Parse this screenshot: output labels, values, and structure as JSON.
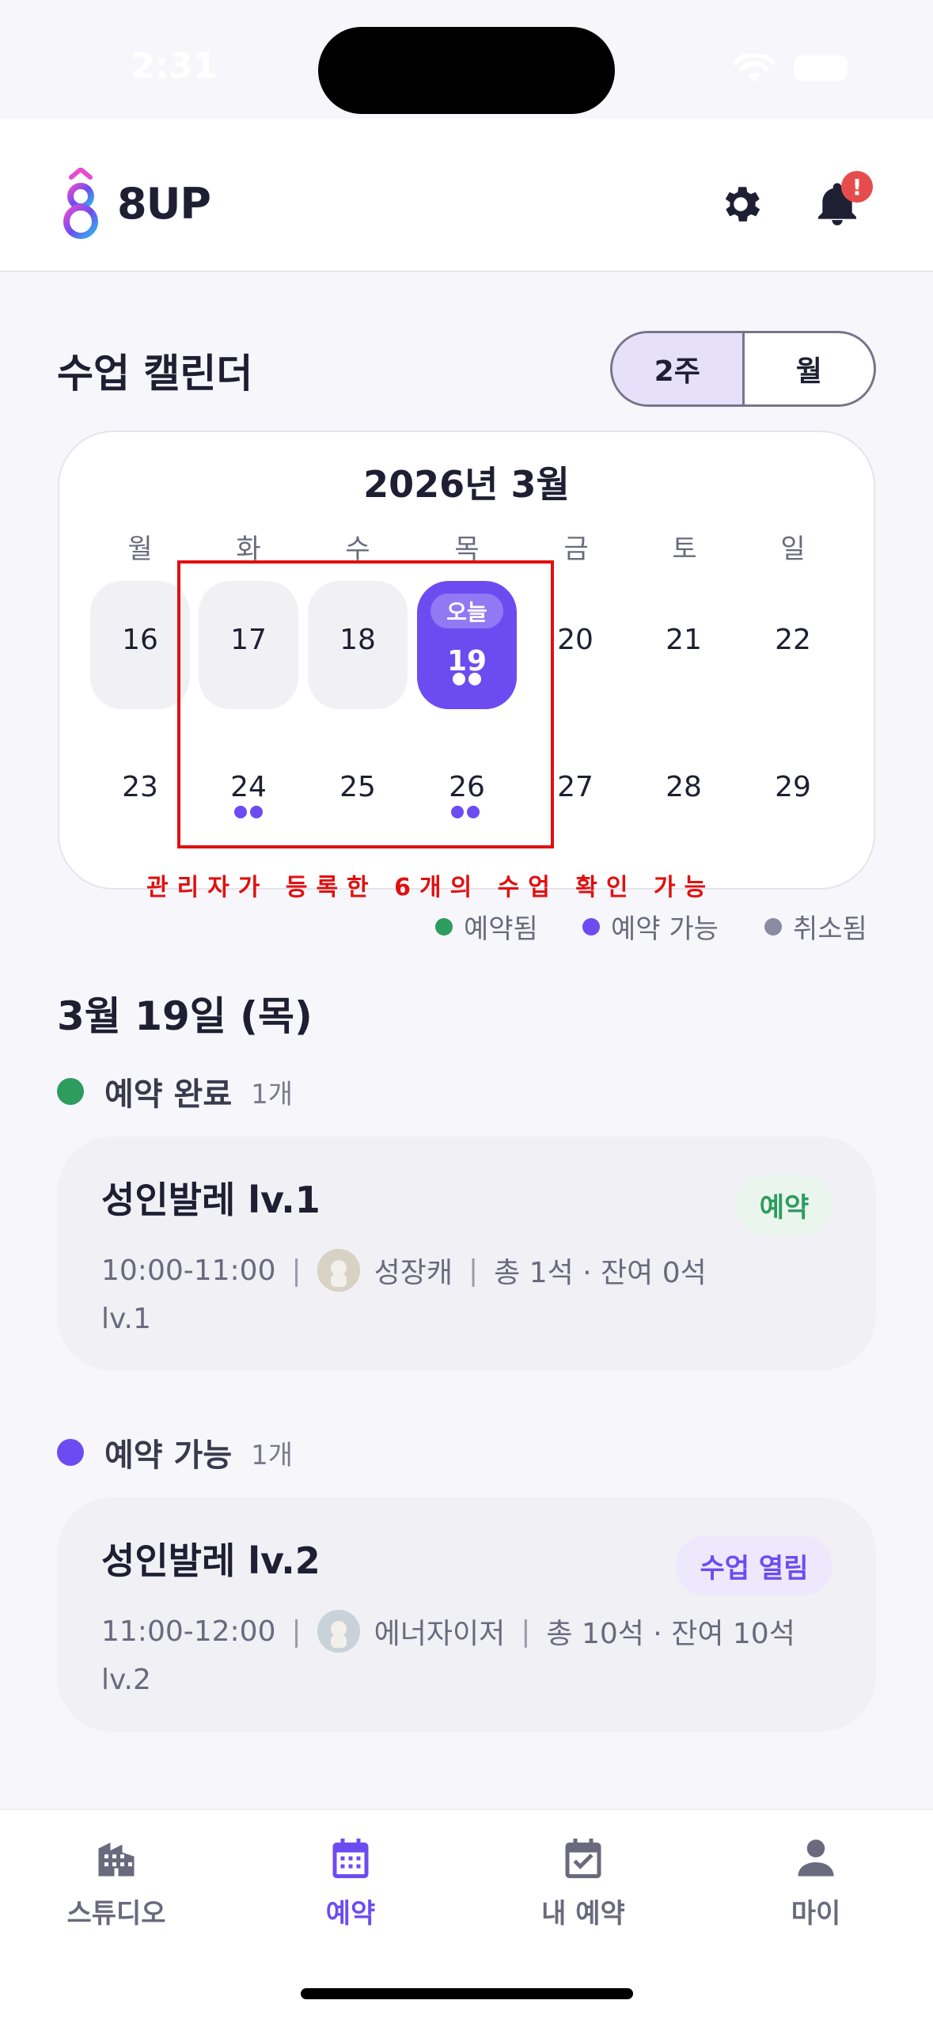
{
  "status_bar": {
    "time": "2:31"
  },
  "header": {
    "app_name": "8UP",
    "notification_badge": "!"
  },
  "calendar": {
    "section_title": "수업 캘린더",
    "view_toggle": {
      "options": [
        "2주",
        "월"
      ],
      "selected": "2주"
    },
    "month_label": "2026년 3월",
    "weekdays": [
      "월",
      "화",
      "수",
      "목",
      "금",
      "토",
      "일"
    ],
    "week1": [
      "16",
      "17",
      "18",
      "19",
      "20",
      "21",
      "22"
    ],
    "week2": [
      "23",
      "24",
      "25",
      "26",
      "27",
      "28",
      "29"
    ],
    "today_label": "오늘",
    "today_date": "19",
    "annotation": "관리자가 등록한 6개의 수업 확인 가능"
  },
  "legend": {
    "booked": "예약됨",
    "available": "예약 가능",
    "cancelled": "취소됨"
  },
  "selected_date": {
    "title": "3월 19일 (목)",
    "groups": [
      {
        "label": "예약 완료",
        "count": "1개",
        "lesson": {
          "title": "성인발레 lv.1",
          "time": "10:00-11:00",
          "instructor": "성장캐",
          "seats": "총 1석 · 잔여 0석",
          "level": "lv.1",
          "tag": "예약"
        }
      },
      {
        "label": "예약 가능",
        "count": "1개",
        "lesson": {
          "title": "성인발레 lv.2",
          "time": "11:00-12:00",
          "instructor": "에너자이저",
          "seats": "총 10석 · 잔여 10석",
          "level": "lv.2",
          "tag": "수업 열림"
        }
      }
    ]
  },
  "bottom_nav": {
    "items": [
      "스튜디오",
      "예약",
      "내 예약",
      "마이"
    ],
    "active": "예약"
  },
  "colors": {
    "accent": "#6C4CF1",
    "booked": "#2E9B5F",
    "cancelled": "#8A8AA0",
    "annotation_red": "#E01010"
  }
}
